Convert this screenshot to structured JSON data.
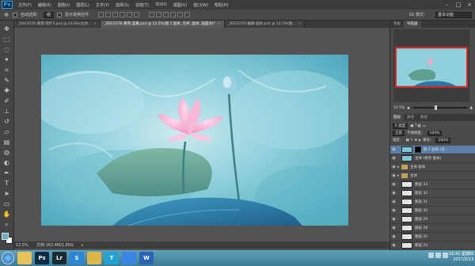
{
  "app": {
    "logo": "Ps"
  },
  "menubar": {
    "items": [
      "文件(F)",
      "编辑(E)",
      "图像(I)",
      "图层(L)",
      "文字(Y)",
      "选择(S)",
      "滤镜(T)",
      "3D(D)",
      "视图(V)",
      "窗口(W)",
      "帮助(H)"
    ]
  },
  "options": {
    "auto_select_label": "自动选择：",
    "auto_select_value": "组",
    "transform_label": "显示变换控件",
    "mode3d": "3D 模式：",
    "workspace": "基本功能"
  },
  "tabs": [
    {
      "label": "_DSC0376-黄荷-荷叶3.psd @ 14.8%(主体...",
      "active": false
    },
    {
      "label": "_DSC0376-黄荷-蓝幕.psd @ 12.5%(图 1 副本, 合并, 副本, 画面/8)*",
      "active": true
    },
    {
      "label": "_DSC0376-编辑-副本.psd @ 12.5%(图...",
      "active": false
    }
  ],
  "tools": [
    "move-icon",
    "marquee-icon",
    "lasso-icon",
    "quick-select-icon",
    "crop-icon",
    "eyedropper-icon",
    "healing-icon",
    "brush-icon",
    "stamp-icon",
    "history-brush-icon",
    "eraser-icon",
    "gradient-icon",
    "blur-icon",
    "dodge-icon",
    "pen-icon",
    "type-icon",
    "path-select-icon",
    "shape-icon",
    "hand-icon",
    "zoom-icon"
  ],
  "status": {
    "zoom": "12.5%",
    "doc": "文档:162.4M/1.85G"
  },
  "right_panel": {
    "tabs": [
      "色板",
      "导航器"
    ],
    "zoom": "12.5%",
    "layers_tabs": [
      "图层",
      "通道",
      "路径"
    ],
    "kind_label": "P 类型",
    "blend": "正常",
    "opacity_label": "不透明度：",
    "opacity": "100%",
    "lock_label": "锁定：",
    "fill_label": "填充：",
    "fill": "100%"
  },
  "layers": [
    {
      "name": "图 1 副本 (合...",
      "selected": true,
      "thumb": "photo",
      "mask": true,
      "arrow": ""
    },
    {
      "name": "主体 (修饰 副本)",
      "selected": false,
      "thumb": "photo",
      "mask": false,
      "arrow": ""
    },
    {
      "name": "主体 副本",
      "selected": false,
      "thumb": "folder",
      "mask": false,
      "arrow": "▸"
    },
    {
      "name": "主体",
      "selected": false,
      "thumb": "folder",
      "mask": false,
      "arrow": "▸"
    },
    {
      "name": "图层 33",
      "selected": false,
      "thumb": "checker",
      "mask": false,
      "arrow": ""
    },
    {
      "name": "图层 32",
      "selected": false,
      "thumb": "checker",
      "mask": false,
      "arrow": ""
    },
    {
      "name": "图层 31",
      "selected": false,
      "thumb": "checker",
      "mask": false,
      "arrow": ""
    },
    {
      "name": "图层 30",
      "selected": false,
      "thumb": "checker",
      "mask": false,
      "arrow": ""
    },
    {
      "name": "图层 29",
      "selected": false,
      "thumb": "checker",
      "mask": false,
      "arrow": ""
    },
    {
      "name": "图层 28",
      "selected": false,
      "thumb": "checker",
      "mask": false,
      "arrow": ""
    },
    {
      "name": "图层 25",
      "selected": false,
      "thumb": "checker",
      "mask": false,
      "arrow": ""
    },
    {
      "name": "图层 24",
      "selected": false,
      "thumb": "checker",
      "mask": false,
      "arrow": ""
    }
  ],
  "taskbar": {
    "apps": [
      {
        "name": "explorer",
        "label": "",
        "color": "#e8c15a"
      },
      {
        "name": "photoshop",
        "label": "Ps",
        "color": "#0a2a45"
      },
      {
        "name": "lightroom",
        "label": "Lr",
        "color": "#1b2b36"
      },
      {
        "name": "sogou",
        "label": "S",
        "color": "#2a86d6"
      },
      {
        "name": "folder",
        "label": "",
        "color": "#e0b64a"
      },
      {
        "name": "typora",
        "label": "T",
        "color": "#22a2d0"
      },
      {
        "name": "pen-app",
        "label": "",
        "color": "#3a86e6"
      },
      {
        "name": "word",
        "label": "W",
        "color": "#2b64b6"
      }
    ],
    "time": "22:41 星期四",
    "date": "2017/2/13"
  }
}
